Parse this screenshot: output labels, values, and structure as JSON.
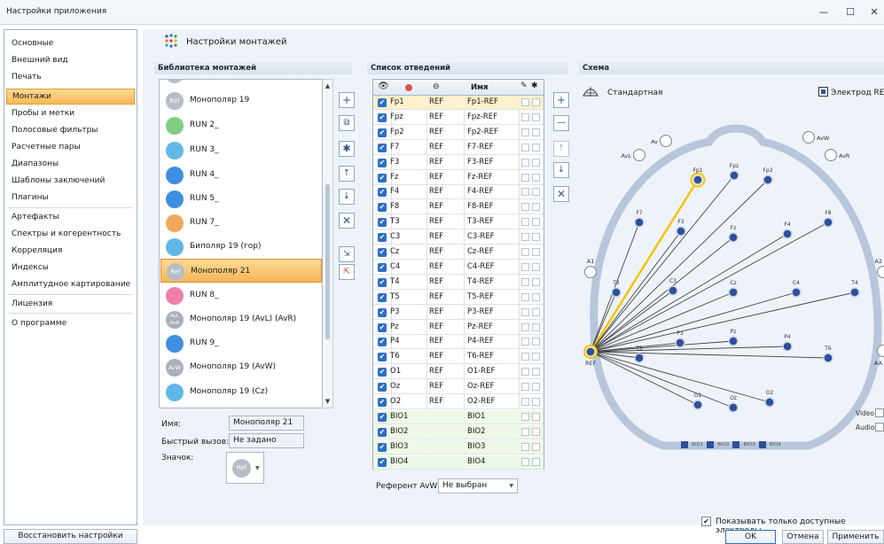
{
  "window": {
    "title": "Настройки приложения",
    "minimize_label": "—",
    "maximize_label": "☐",
    "close_label": "✕"
  },
  "sidebar": {
    "items": [
      {
        "label": "Основные"
      },
      {
        "label": "Внешний вид"
      },
      {
        "label": "Печать"
      },
      {
        "label": "Монтажи",
        "active": true
      },
      {
        "label": "Пробы и метки"
      },
      {
        "label": "Полосовые фильтры"
      },
      {
        "label": "Расчетные пары"
      },
      {
        "label": "Диапазоны"
      },
      {
        "label": "Шаблоны заключений"
      },
      {
        "label": "Плагины"
      },
      {
        "label": "Артефакты"
      },
      {
        "label": "Спектры и когерентность"
      },
      {
        "label": "Корреляция"
      },
      {
        "label": "Индексы"
      },
      {
        "label": "Амплитудное картирование"
      },
      {
        "label": "Лицензия"
      },
      {
        "label": "О программе"
      }
    ],
    "restore_button": "Восстановить настройки"
  },
  "page": {
    "title": "Настройки монтажей"
  },
  "library": {
    "header": "Библиотека монтажей",
    "items": [
      {
        "label": "Монополяр 19",
        "icon": "ref-icon",
        "icon_text": "Ref",
        "color": "#b7bcc6"
      },
      {
        "label": "RUN 2_",
        "icon": "dot-grid-icon",
        "icon_text": "",
        "color": "#7fcf83"
      },
      {
        "label": "RUN 3_",
        "icon": "dot-grid-icon",
        "icon_text": "",
        "color": "#63b8e8"
      },
      {
        "label": "RUN 4_",
        "icon": "dot-grid-icon",
        "icon_text": "",
        "color": "#3f8fe0"
      },
      {
        "label": "RUN 5_",
        "icon": "dot-grid-icon",
        "icon_text": "",
        "color": "#3f8fe0"
      },
      {
        "label": "RUN 7_",
        "icon": "dot-grid-icon",
        "icon_text": "",
        "color": "#f0a85a"
      },
      {
        "label": "Биполяр 19 (гор)",
        "icon": "dot-grid-icon",
        "icon_text": "",
        "color": "#5fb8e6"
      },
      {
        "label": "Монополяр 21",
        "icon": "ref-icon",
        "icon_text": "Ref",
        "color": "#b7bcc6",
        "selected": true
      },
      {
        "label": "RUN 8_",
        "icon": "dot-grid-icon",
        "icon_text": "",
        "color": "#ee7fa8"
      },
      {
        "label": "Монополяр 19 (AvL) (AvR)",
        "icon": "avl-avr-icon",
        "icon_text": "AvL AvR",
        "color": "#aab0ba"
      },
      {
        "label": "RUN 9_",
        "icon": "dot-grid-icon",
        "icon_text": "",
        "color": "#3f8fe0"
      },
      {
        "label": "Монополяр 19 (AvW)",
        "icon": "avw-icon",
        "icon_text": "AvW",
        "color": "#aab0ba"
      },
      {
        "label": "Монополяр 19 (Cz)",
        "icon": "dot-grid-icon",
        "icon_text": "",
        "color": "#5fb8e6"
      }
    ],
    "name_label": "Имя:",
    "name_value": "Монополяр 21",
    "hotkey_label": "Быстрый вызов:",
    "hotkey_value": "Не задано",
    "icon_label": "Значок:",
    "icon_value": "Ref"
  },
  "leads": {
    "header": "Список отведений",
    "name_column": "Имя",
    "rows": [
      {
        "a": "Fp1",
        "b": "REF",
        "name": "Fp1-REF"
      },
      {
        "a": "Fpz",
        "b": "REF",
        "name": "Fpz-REF"
      },
      {
        "a": "Fp2",
        "b": "REF",
        "name": "Fp2-REF"
      },
      {
        "a": "F7",
        "b": "REF",
        "name": "F7-REF"
      },
      {
        "a": "F3",
        "b": "REF",
        "name": "F3-REF"
      },
      {
        "a": "Fz",
        "b": "REF",
        "name": "Fz-REF"
      },
      {
        "a": "F4",
        "b": "REF",
        "name": "F4-REF"
      },
      {
        "a": "F8",
        "b": "REF",
        "name": "F8-REF"
      },
      {
        "a": "T3",
        "b": "REF",
        "name": "T3-REF"
      },
      {
        "a": "C3",
        "b": "REF",
        "name": "C3-REF"
      },
      {
        "a": "Cz",
        "b": "REF",
        "name": "Cz-REF"
      },
      {
        "a": "C4",
        "b": "REF",
        "name": "C4-REF"
      },
      {
        "a": "T4",
        "b": "REF",
        "name": "T4-REF"
      },
      {
        "a": "T5",
        "b": "REF",
        "name": "T5-REF"
      },
      {
        "a": "P3",
        "b": "REF",
        "name": "P3-REF"
      },
      {
        "a": "Pz",
        "b": "REF",
        "name": "Pz-REF"
      },
      {
        "a": "P4",
        "b": "REF",
        "name": "P4-REF"
      },
      {
        "a": "T6",
        "b": "REF",
        "name": "T6-REF"
      },
      {
        "a": "O1",
        "b": "REF",
        "name": "O1-REF"
      },
      {
        "a": "Oz",
        "b": "REF",
        "name": "Oz-REF"
      },
      {
        "a": "O2",
        "b": "REF",
        "name": "O2-REF"
      },
      {
        "a": "BIO1",
        "b": "",
        "name": "BIO1"
      },
      {
        "a": "BIO2",
        "b": "",
        "name": "BIO2"
      },
      {
        "a": "BIO3",
        "b": "",
        "name": "BIO3"
      },
      {
        "a": "BIO4",
        "b": "",
        "name": "BIO4"
      }
    ],
    "ref_avw_label": "Референт AvW:",
    "ref_avw_value": "Не выбран"
  },
  "scheme": {
    "header": "Схема",
    "standard_label": "Стандартная",
    "electrode_ref_label": "Электрод REF",
    "ref_label": "REF",
    "electrodes": [
      "Fp1",
      "Fpz",
      "Fp2",
      "F7",
      "F3",
      "Fz",
      "F4",
      "F8",
      "T3",
      "C3",
      "Cz",
      "C4",
      "T4",
      "T5",
      "P3",
      "Pz",
      "P4",
      "T6",
      "O1",
      "Oz",
      "O2"
    ],
    "outer_labels": [
      "Av",
      "AvW",
      "AvL",
      "AvR",
      "A1",
      "A2",
      "AA"
    ],
    "bio_legend": [
      "BIO1",
      "BIO2",
      "BIO3",
      "BIO4"
    ],
    "video_label": "Video",
    "audio_label": "Audio",
    "show_only_label": "Показывать только доступные электроды"
  },
  "buttons": {
    "ok": "OK",
    "cancel": "Отмена",
    "apply": "Применить"
  },
  "colors": {
    "accent": "#f6b957",
    "highlight_line": "#f5c400",
    "electrode": "#2f4f9a",
    "head": "#b8c6dc"
  }
}
